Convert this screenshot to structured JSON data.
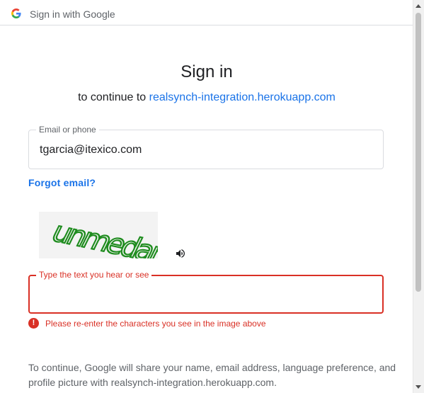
{
  "header": {
    "title": "Sign in with Google"
  },
  "main": {
    "heading": "Sign in",
    "subheading_prefix": "to continue to ",
    "subheading_link": "realsynch-integration.herokuapp.com",
    "email_field": {
      "label": "Email or phone",
      "value": "tgarcia@itexico.com"
    },
    "forgot_link": "Forgot email?",
    "captcha": {
      "image_text": "unmedan",
      "audio_icon": "speaker-icon",
      "field_label": "Type the text you hear or see",
      "value": "",
      "error": "Please re-enter the characters you see in the image above"
    },
    "notice": "To continue, Google will share your name, email address, language preference, and profile picture with realsynch-integration.herokuapp.com."
  },
  "colors": {
    "link": "#1a73e8",
    "error": "#d93025",
    "border": "#dadce0",
    "captcha_text": "#1e8c1e"
  }
}
